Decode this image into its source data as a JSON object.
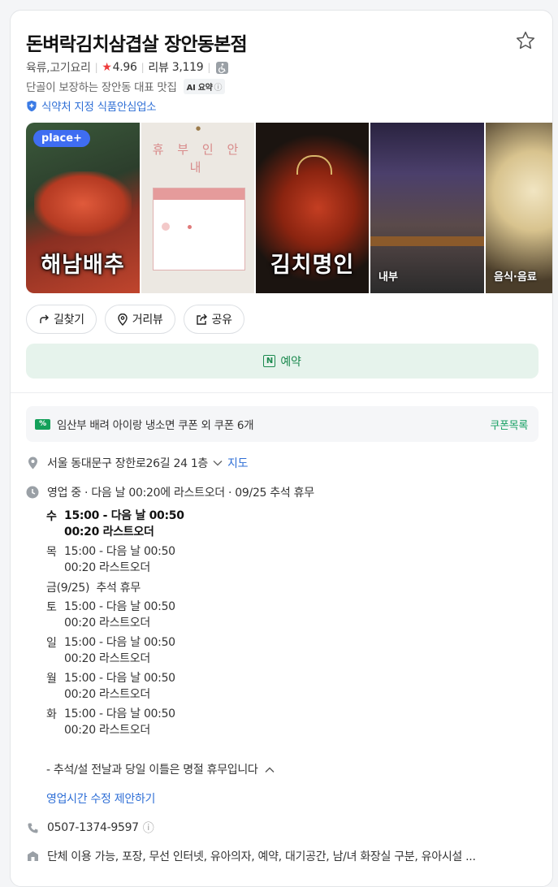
{
  "place": {
    "name": "돈벼락김치삼겹살 장안동본점",
    "category": "육류,고기요리",
    "rating": "4.96",
    "review_label": "리뷰",
    "review_count": "3,119",
    "description": "단골이 보장하는 장안동 대표 맛집",
    "ai_badge": "AI 요약",
    "safety_label": "식약처 지정 식품안심업소"
  },
  "photos": {
    "badge": "place+",
    "items": [
      {
        "label": "해남배추",
        "icon": "kimchi-photo"
      },
      {
        "label": "휴 부 인 안 내",
        "icon": "notice-photo"
      },
      {
        "label": "김치명인",
        "icon": "kimchi-photo"
      },
      {
        "label": "내부",
        "icon": "interior-photo"
      },
      {
        "label": "음식·음료",
        "icon": "food-photo"
      }
    ]
  },
  "actions": {
    "directions": "길찾기",
    "streetview": "거리뷰",
    "share": "공유",
    "reserve": "예약"
  },
  "coupon": {
    "text": "임산부 배려 아이랑 냉소면 쿠폰 외 쿠폰 6개",
    "link": "쿠폰목록"
  },
  "address": {
    "text": "서울 동대문구 장한로26길 24 1층",
    "map_link": "지도"
  },
  "status": {
    "summary": "영업 중 · 다음 날 00:20에 라스트오더 · 09/25 추석 휴무"
  },
  "hours": [
    {
      "day": "수",
      "time": "15:00 - 다음 날 00:50",
      "last": "00:20 라스트오더",
      "today": true
    },
    {
      "day": "목",
      "time": "15:00 - 다음 날 00:50",
      "last": "00:20 라스트오더"
    },
    {
      "day": "금(9/25)",
      "time": "추석 휴무",
      "last": ""
    },
    {
      "day": "토",
      "time": "15:00 - 다음 날 00:50",
      "last": "00:20 라스트오더"
    },
    {
      "day": "일",
      "time": "15:00 - 다음 날 00:50",
      "last": "00:20 라스트오더"
    },
    {
      "day": "월",
      "time": "15:00 - 다음 날 00:50",
      "last": "00:20 라스트오더"
    },
    {
      "day": "화",
      "time": "15:00 - 다음 날 00:50",
      "last": "00:20 라스트오더"
    }
  ],
  "holiday_note": "- 추석/설 전날과 당일 이틀은 명절 휴무입니다",
  "hours_suggest": "영업시간 수정 제안하기",
  "phone": "0507-1374-9597",
  "facilities": "단체 이용 가능, 포장, 무선 인터넷, 유아의자, 예약, 대기공간, 남/녀 화장실 구분, 유아시설 ...",
  "colors": {
    "accent_green": "#1c8a4f",
    "link_blue": "#2f6fd6",
    "star_red": "#ee3b3b"
  }
}
